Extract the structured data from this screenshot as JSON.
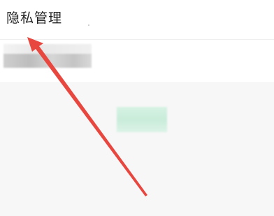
{
  "header": {
    "title": "隐私管理"
  },
  "colors": {
    "arrow": "#e8473f",
    "header_bg": "#ffffff",
    "page_bg": "#f7f7f7",
    "title_text": "#222222"
  },
  "annotation": {
    "icon": "red-arrow-icon"
  }
}
